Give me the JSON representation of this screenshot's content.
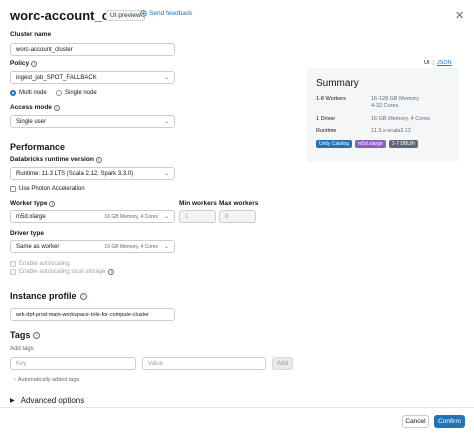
{
  "header": {
    "title": "worc-account_cluster",
    "preview_badge": "UI preview",
    "feedback_label": "Send feedback"
  },
  "form": {
    "cluster_name_label": "Cluster name",
    "cluster_name_value": "worc-account_cluster",
    "policy_label": "Policy",
    "policy_value": "ingest_job_SPOT_FALLBACK",
    "node_mode": {
      "multi_label": "Multi node",
      "single_label": "Single node",
      "selected": "Multi node"
    },
    "access_mode_label": "Access mode",
    "access_mode_value": "Single user"
  },
  "view_toggle": {
    "ui_label": "UI",
    "separator": "|",
    "json_label": "JSON"
  },
  "performance": {
    "heading": "Performance",
    "runtime_label": "Databricks runtime version",
    "runtime_value": "Runtime: 11.3 LTS (Scala 2.12, Spark 3.3.0)",
    "photon_label": "Use Photon Acceleration",
    "worker_type_label": "Worker type",
    "worker_type_value": "m5d.xlarge",
    "worker_type_meta": "16 GB Memory, 4 Cores",
    "min_workers_label": "Min workers",
    "min_workers_value": "1",
    "max_workers_label": "Max workers",
    "max_workers_value": "8",
    "driver_type_label": "Driver type",
    "driver_type_value": "Same as worker",
    "driver_type_meta": "16 GB Memory, 4 Cores",
    "autoscaling_label": "Enable autoscaling",
    "autoscaling_storage_label": "Enable autoscaling local storage"
  },
  "instance_profile": {
    "heading": "Instance profile",
    "value": "wrk-dpf-prod-main-workspace-role-for-compute-cluster"
  },
  "tags": {
    "heading": "Tags",
    "add_label": "Add tags",
    "key_placeholder": "Key",
    "value_placeholder": "Value",
    "add_button": "Add",
    "auto_tags_label": "Automatically added tags"
  },
  "advanced": {
    "label": "Advanced options"
  },
  "summary": {
    "title": "Summary",
    "rows": [
      {
        "key": "1-8 Workers",
        "value_line1": "16-128 GB Memory",
        "value_line2": "4-32 Cores"
      },
      {
        "key": "1 Driver",
        "value_line1": "16 GB Memory, 4 Cores",
        "value_line2": ""
      },
      {
        "key": "Runtime",
        "value_line1": "11.3.x-scala2.12",
        "value_line2": ""
      }
    ],
    "tags": [
      {
        "label": "Unity Catalog",
        "color": "#2272b4"
      },
      {
        "label": "m5d.xlarge",
        "color": "#8a5fc7"
      },
      {
        "label": "1-7 DBU/h",
        "color": "#5f6a74"
      }
    ]
  },
  "footer": {
    "cancel_label": "Cancel",
    "confirm_label": "Confirm"
  },
  "colors": {
    "accent": "#2272b4",
    "border": "#c9ced3"
  }
}
